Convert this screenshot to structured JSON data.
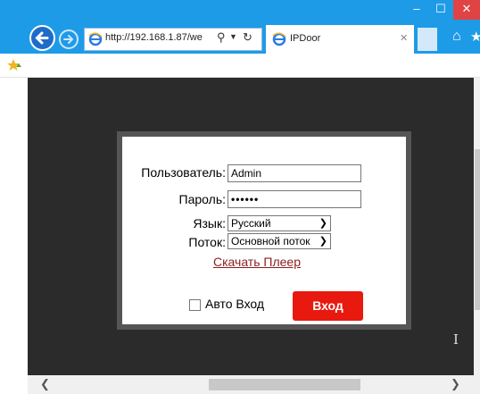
{
  "browser": {
    "url": "http://192.168.1.87/we",
    "tab_title": "IPDoor",
    "minimize_glyph": "‒",
    "maximize_glyph": "☐",
    "close_glyph": "✕"
  },
  "form": {
    "username_label": "Пользователь:",
    "username_value": "Admin",
    "password_label": "Пароль:",
    "password_value": "••••••",
    "language_label": "Язык:",
    "language_value": "Русский",
    "stream_label": "Поток:",
    "stream_value": "Основной поток",
    "download_link": "Скачать Плеер",
    "auto_login_label": "Авто Вход",
    "login_button": "Вход"
  }
}
